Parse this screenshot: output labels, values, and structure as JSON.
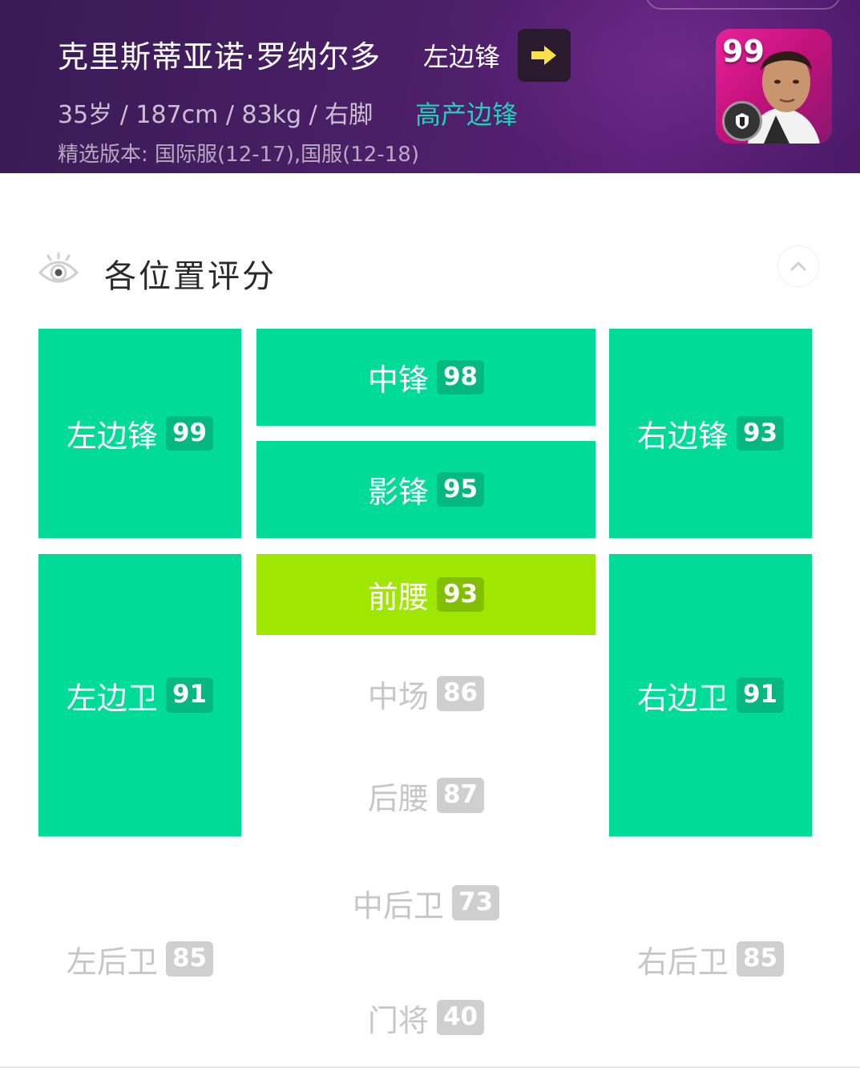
{
  "header": {
    "name": "克里斯蒂亚诺·罗纳尔多",
    "position": "左边锋",
    "info": "35岁 / 187cm / 83kg / 右脚",
    "tag": "高产边锋",
    "version": "精选版本: 国际服(12-17),国服(12-18)",
    "card_rating": "99",
    "card_gradient": [
      "#e9219a",
      "#8a1770"
    ]
  },
  "section": {
    "title": "各位置评分",
    "icon": "eye-icon",
    "collapse_icon": "chevron-up-icon"
  },
  "colors": {
    "high": "#00dc97",
    "mid": "#9fe600",
    "low": "#c6c6c6"
  },
  "positions": {
    "lwf": {
      "label": "左边锋",
      "score": "99"
    },
    "cf": {
      "label": "中锋",
      "score": "98"
    },
    "rwf": {
      "label": "右边锋",
      "score": "93"
    },
    "ss": {
      "label": "影锋",
      "score": "95"
    },
    "lmf": {
      "label": "左边卫",
      "score": "91"
    },
    "amf": {
      "label": "前腰",
      "score": "93"
    },
    "rmf": {
      "label": "右边卫",
      "score": "91"
    },
    "cmf": {
      "label": "中场",
      "score": "86"
    },
    "dmf": {
      "label": "后腰",
      "score": "87"
    },
    "cb": {
      "label": "中后卫",
      "score": "73"
    },
    "lb": {
      "label": "左后卫",
      "score": "85"
    },
    "rb": {
      "label": "右后卫",
      "score": "85"
    },
    "gk": {
      "label": "门将",
      "score": "40"
    }
  }
}
